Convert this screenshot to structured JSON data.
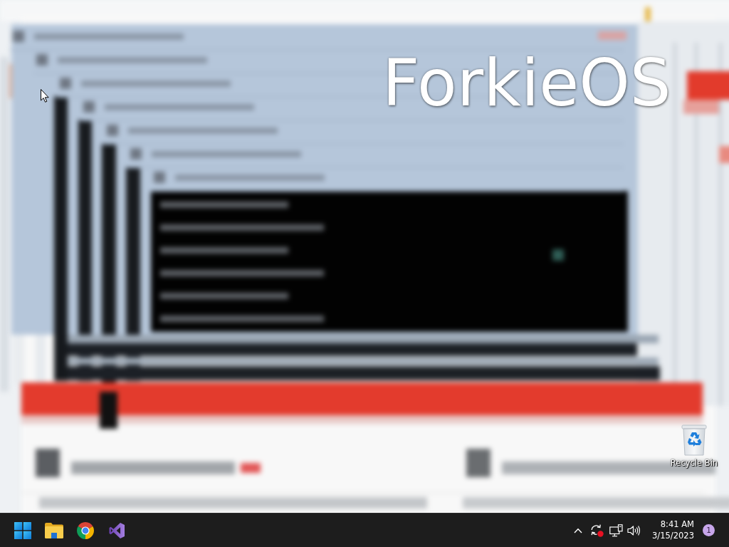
{
  "desktop": {
    "title_overlay": "ForkieOS",
    "icons": [
      {
        "label": "Recycle Bin"
      }
    ]
  },
  "taskbar": {
    "clock": {
      "time": "8:41 AM",
      "date": "3/15/2023"
    },
    "notification_count": "1"
  }
}
